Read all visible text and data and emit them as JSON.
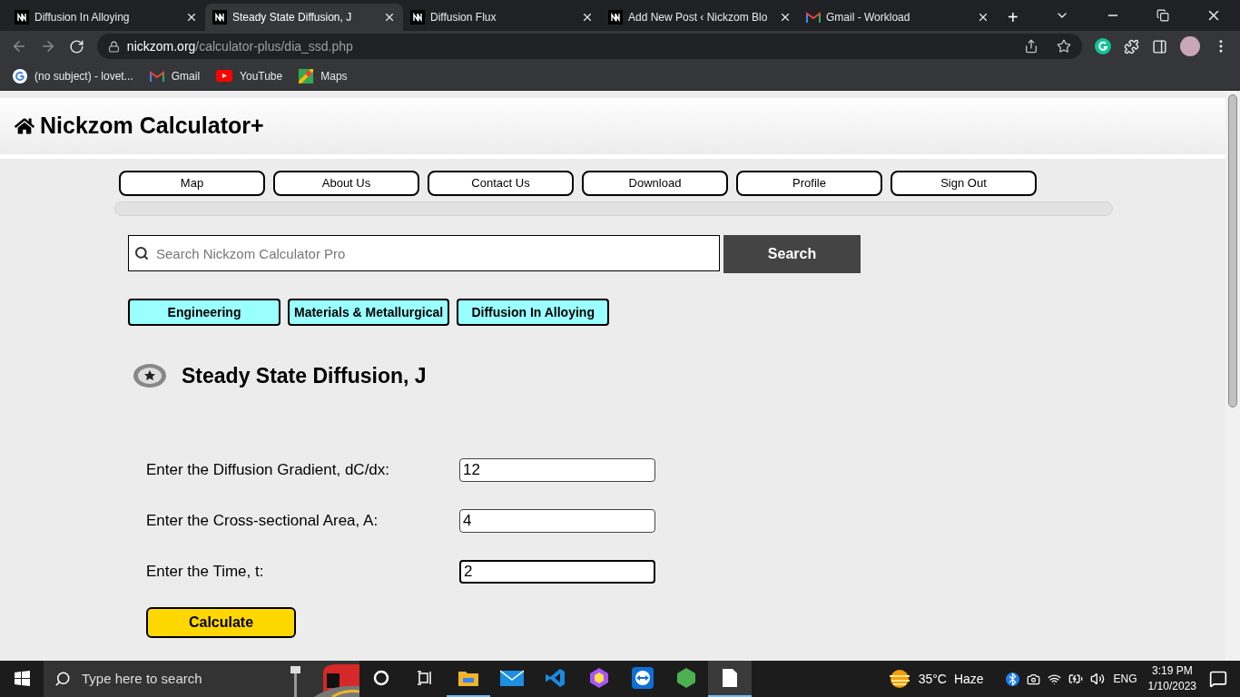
{
  "browser": {
    "tabs": [
      {
        "title": "Diffusion In Alloying",
        "selected": false
      },
      {
        "title": "Steady State Diffusion, J",
        "selected": true
      },
      {
        "title": "Diffusion Flux",
        "selected": false
      },
      {
        "title": "Add New Post ‹ Nickzom Blo",
        "selected": false
      },
      {
        "title": "Gmail - Workload",
        "selected": false,
        "kind": "gmail"
      }
    ],
    "new_tab": "+",
    "address": {
      "host": "nickzom.org",
      "path": "/calculator-plus/dia_ssd.php"
    },
    "bookmarks": [
      {
        "label": "(no subject) - lovet...",
        "kind": "google"
      },
      {
        "label": "Gmail",
        "kind": "gmail"
      },
      {
        "label": "YouTube",
        "kind": "youtube"
      },
      {
        "label": "Maps",
        "kind": "maps"
      }
    ]
  },
  "site": {
    "title": "Nickzom Calculator+",
    "nav": [
      "Map",
      "About Us",
      "Contact Us",
      "Download",
      "Profile",
      "Sign Out"
    ],
    "search": {
      "placeholder": "Search Nickzom Calculator Pro",
      "button": "Search"
    },
    "breadcrumbs": [
      "Engineering",
      "Materials & Metallurgical",
      "Diffusion In Alloying"
    ],
    "heading": "Steady State Diffusion, J",
    "fields": [
      {
        "label": "Enter the Diffusion Gradient, dC/dx:",
        "value": "12",
        "focused": false
      },
      {
        "label": "Enter the Cross-sectional Area, A:",
        "value": "4",
        "focused": false
      },
      {
        "label": "Enter the Time, t:",
        "value": "2",
        "focused": true
      }
    ],
    "calculate": "Calculate"
  },
  "taskbar": {
    "search_placeholder": "Type here to search",
    "apps": [
      {
        "kind": "cortana",
        "running": false,
        "active": false
      },
      {
        "kind": "taskview",
        "running": false,
        "active": false
      },
      {
        "kind": "explorer",
        "running": true,
        "active": false
      },
      {
        "kind": "mail",
        "running": false,
        "active": false
      },
      {
        "kind": "vscode",
        "running": false,
        "active": false
      },
      {
        "kind": "cube",
        "running": false,
        "active": false
      },
      {
        "kind": "teamviewer",
        "running": false,
        "active": false
      },
      {
        "kind": "node",
        "running": false,
        "active": false
      },
      {
        "kind": "file",
        "running": true,
        "active": true
      }
    ],
    "weather": {
      "temp": "35°C",
      "condition": "Haze"
    },
    "language": "ENG",
    "time": "3:19 PM",
    "date": "1/10/2023"
  }
}
